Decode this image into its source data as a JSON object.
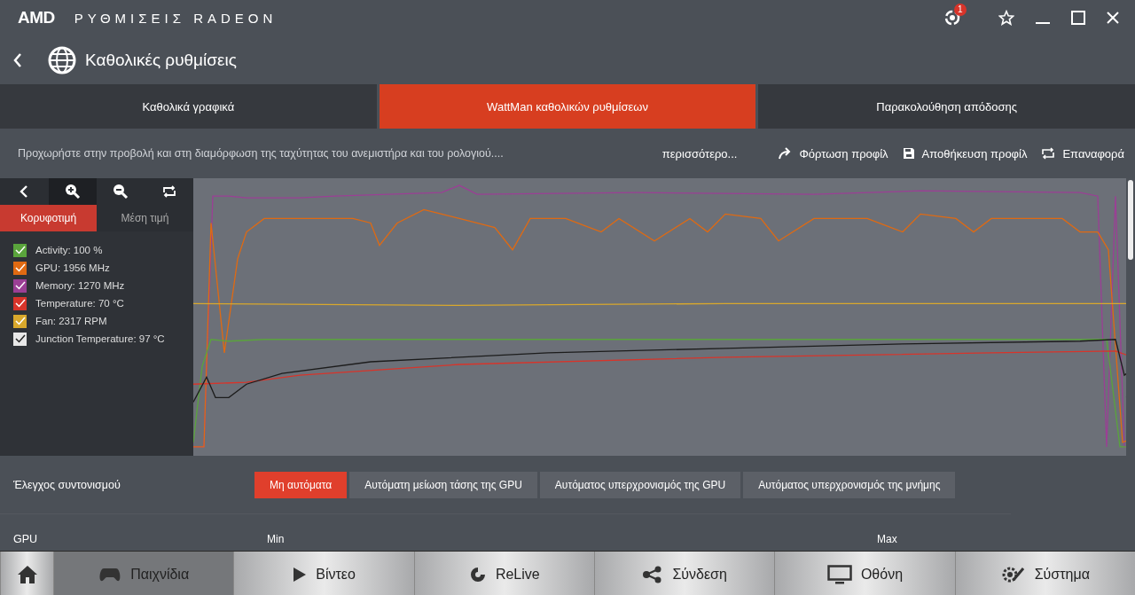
{
  "app": {
    "brand": "AMD",
    "title": "ΡΥΘΜΙΣΕΙΣ RADEON",
    "notification_count": "1"
  },
  "header": {
    "title": "Καθολικές ρυθμίσεις"
  },
  "tabs": [
    {
      "label": "Καθολικά γραφικά",
      "selected": false
    },
    {
      "label": "WattMan καθολικών ρυθμίσεων",
      "selected": true
    },
    {
      "label": "Παρακολούθηση απόδοσης",
      "selected": false
    }
  ],
  "description": "Προχωρήστε στην προβολή και στη διαμόρφωση της ταχύτητας του ανεμιστήρα και του ρολογιού....",
  "more_link": "περισσότερο...",
  "actions": [
    {
      "kind": "load",
      "label": "Φόρτωση προφίλ"
    },
    {
      "kind": "save",
      "label": "Αποθήκευση προφίλ"
    },
    {
      "kind": "reset",
      "label": "Επαναφορά"
    }
  ],
  "chart_panel": {
    "modes": [
      {
        "label": "Κορυφοτιμή",
        "selected": true
      },
      {
        "label": "Μέση τιμή",
        "selected": false
      }
    ],
    "legend": [
      {
        "label": "Activity: 100 %",
        "color": "#5aa43c",
        "checked": true
      },
      {
        "label": "GPU: 1956 MHz",
        "color": "#e06a12",
        "checked": true
      },
      {
        "label": "Memory: 1270 MHz",
        "color": "#9b3f95",
        "checked": true
      },
      {
        "label": "Temperature: 70 °C",
        "color": "#d8342a",
        "checked": true
      },
      {
        "label": "Fan: 2317 RPM",
        "color": "#d9a82c",
        "checked": true
      },
      {
        "label": "Junction Temperature: 97 °C",
        "color": "#e8e8e8",
        "checked": true
      }
    ]
  },
  "tuning": {
    "label": "Έλεγχος συντονισμού",
    "options": [
      {
        "label": "Μη αυτόματα",
        "selected": true
      },
      {
        "label": "Αυτόματη μείωση τάσης της GPU",
        "selected": false
      },
      {
        "label": "Αυτόματος υπερχρονισμός της GPU",
        "selected": false
      },
      {
        "label": "Αυτόματος υπερχρονισμός της μνήμης",
        "selected": false
      }
    ]
  },
  "gpu_row": {
    "label": "GPU",
    "min_label": "Min",
    "max_label": "Max"
  },
  "nav": [
    {
      "kind": "home",
      "selected": false
    },
    {
      "kind": "games",
      "label": "Παιχνίδια",
      "selected": true
    },
    {
      "kind": "video",
      "label": "Βίντεο",
      "selected": false
    },
    {
      "kind": "relive",
      "label": "ReLive",
      "selected": false
    },
    {
      "kind": "connect",
      "label": "Σύνδεση",
      "selected": false
    },
    {
      "kind": "display",
      "label": "Οθόνη",
      "selected": false
    },
    {
      "kind": "system",
      "label": "Σύστημα",
      "selected": false
    }
  ]
}
